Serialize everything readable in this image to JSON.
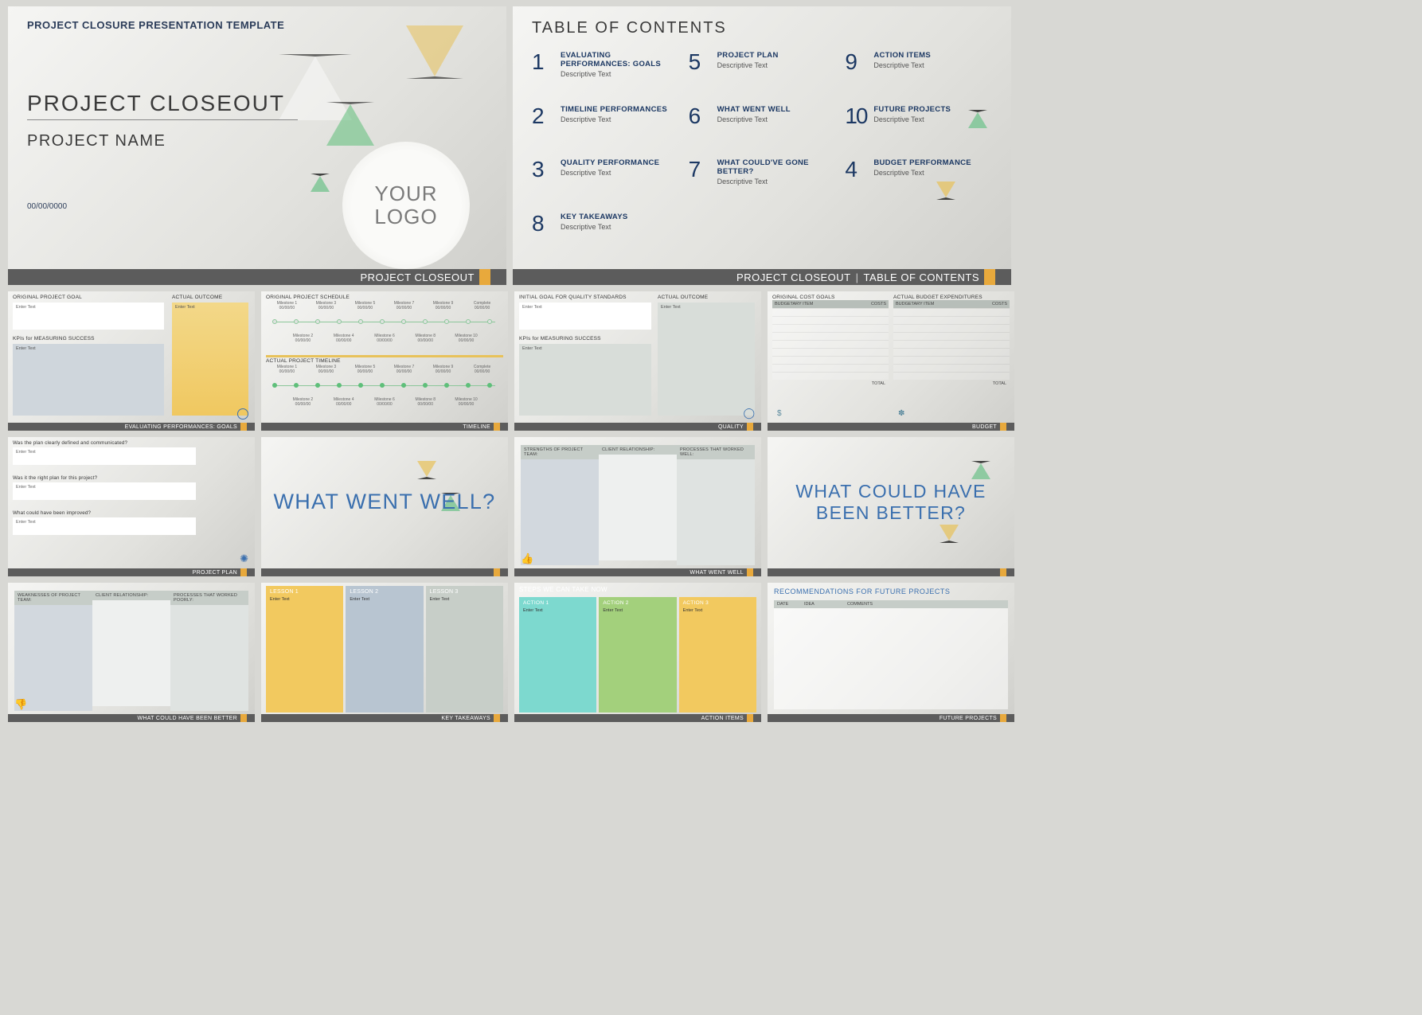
{
  "enterText": "Enter Text",
  "dateFmt": "00/00/00",
  "slide1": {
    "header": "PROJECT CLOSURE PRESENTATION TEMPLATE",
    "title": "PROJECT CLOSEOUT",
    "subtitle": "PROJECT NAME",
    "date": "00/00/0000",
    "logo": "YOUR LOGO",
    "footer": "PROJECT CLOSEOUT"
  },
  "slide2": {
    "header": "TABLE OF CONTENTS",
    "footer_left": "PROJECT CLOSEOUT",
    "footer_sep": "|",
    "footer_right": "TABLE OF CONTENTS",
    "items": [
      {
        "n": "1",
        "h": "EVALUATING PERFORMANCES: GOALS",
        "d": "Descriptive Text"
      },
      {
        "n": "5",
        "h": "PROJECT PLAN",
        "d": "Descriptive Text"
      },
      {
        "n": "9",
        "h": "ACTION ITEMS",
        "d": "Descriptive Text"
      },
      {
        "n": "2",
        "h": "TIMELINE PERFORMANCES",
        "d": "Descriptive Text"
      },
      {
        "n": "6",
        "h": "WHAT WENT WELL",
        "d": "Descriptive Text"
      },
      {
        "n": "10",
        "h": "FUTURE PROJECTS",
        "d": "Descriptive Text"
      },
      {
        "n": "3",
        "h": "QUALITY PERFORMANCE",
        "d": "Descriptive Text"
      },
      {
        "n": "7",
        "h": "WHAT COULD'VE GONE BETTER?",
        "d": "Descriptive Text"
      },
      {
        "n": "4",
        "h": "BUDGET PERFORMANCE",
        "d": "Descriptive Text"
      },
      {
        "n": "8",
        "h": "KEY TAKEAWAYS",
        "d": "Descriptive Text"
      }
    ]
  },
  "slide3": {
    "l1": "ORIGINAL PROJECT GOAL",
    "l2": "KPIs for MEASURING SUCCESS",
    "l3": "ACTUAL OUTCOME",
    "footer": "EVALUATING PERFORMANCES: GOALS"
  },
  "slide4": {
    "h1": "ORIGINAL PROJECT SCHEDULE",
    "h2": "ACTUAL PROJECT TIMELINE",
    "milestonesTop": [
      "Milestone 1",
      "Milestone 3",
      "Milestone 5",
      "Milestone 7",
      "Milestone 9",
      "Complete"
    ],
    "milestonesBot": [
      "Milestone 2",
      "Milestone 4",
      "Milestone 6",
      "Milestone 8",
      "Milestone 10"
    ],
    "footer": "TIMELINE"
  },
  "slide5": {
    "l1": "INITIAL GOAL FOR QUALITY STANDARDS",
    "l2": "KPIs for MEASURING SUCCESS",
    "l3": "ACTUAL OUTCOME",
    "footer": "QUALITY"
  },
  "slide6": {
    "hL": "ORIGINAL COST GOALS",
    "hR": "ACTUAL BUDGET EXPENDITURES",
    "colA": "BUDGETARY ITEM",
    "colB": "COSTS",
    "total": "TOTAL",
    "footer": "BUDGET"
  },
  "slide7": {
    "q1": "Was the plan clearly defined and communicated?",
    "q2": "Was it the right plan for this project?",
    "q3": "What could have been improved?",
    "footer": "PROJECT PLAN"
  },
  "slide8": {
    "text": "WHAT WENT WELL?"
  },
  "slide9": {
    "c1": "STRENGTHS OF PROJECT TEAM:",
    "c2": "CLIENT RELATIONSHIP:",
    "c3": "PROCESSES THAT WORKED WELL:",
    "footer": "WHAT WENT WELL"
  },
  "slide10": {
    "l1": "LESSON 1",
    "l2": "LESSON 2",
    "l3": "LESSON 3",
    "footer": "KEY TAKEAWAYS"
  },
  "slide11": {
    "top": "STEPS WE CAN TAKE NOW",
    "a1": "ACTION 1",
    "a2": "ACTION 2",
    "a3": "ACTION 3",
    "footer": "ACTION ITEMS"
  },
  "slide12": {
    "text": "WHAT COULD HAVE BEEN BETTER?"
  },
  "slide13": {
    "c1": "WEAKNESSES OF PROJECT TEAM:",
    "c2": "CLIENT RELATIONSHIP:",
    "c3": "PROCESSES THAT WORKED POORLY:",
    "footer": "WHAT COULD HAVE BEEN BETTER"
  },
  "slide14": {
    "hdr": "RECOMMENDATIONS FOR FUTURE PROJECTS",
    "cD": "DATE",
    "cI": "IDEA",
    "cC": "COMMENTS",
    "footer": "FUTURE PROJECTS"
  }
}
